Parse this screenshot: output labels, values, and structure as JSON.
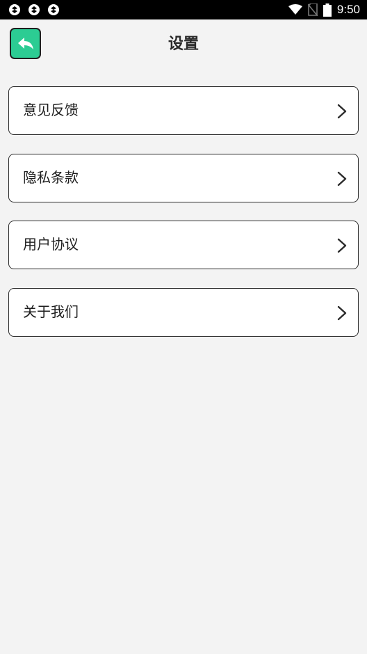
{
  "status_bar": {
    "time": "9:50",
    "left_icons": [
      "app-notification-icon",
      "app-notification-icon",
      "app-notification-icon"
    ],
    "right_icons": [
      "wifi-icon",
      "no-sim-icon",
      "battery-icon"
    ]
  },
  "header": {
    "title": "设置",
    "back_icon": "back-arrow-icon",
    "back_color": "#2ccc93"
  },
  "menu": {
    "items": [
      {
        "label": "意见反馈",
        "icon": "chevron-right-icon"
      },
      {
        "label": "隐私条款",
        "icon": "chevron-right-icon"
      },
      {
        "label": "用户协议",
        "icon": "chevron-right-icon"
      },
      {
        "label": "关于我们",
        "icon": "chevron-right-icon"
      }
    ]
  },
  "colors": {
    "background": "#f3f3f3",
    "card": "#ffffff",
    "accent": "#2ccc93",
    "border": "#2b2b2b"
  }
}
